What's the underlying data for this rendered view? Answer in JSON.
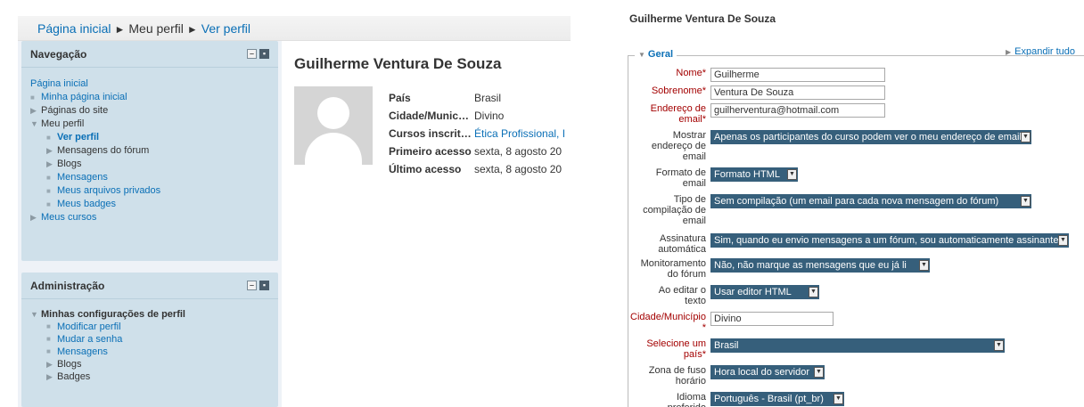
{
  "breadcrumb": {
    "items": [
      "Página inicial",
      "Meu perfil",
      "Ver perfil"
    ],
    "separator": "►"
  },
  "navigation": {
    "title": "Navegação",
    "home": "Página inicial",
    "items": [
      {
        "label": "Minha página inicial"
      },
      {
        "label": "Páginas do site"
      },
      {
        "label": "Meu perfil"
      },
      {
        "label": "Ver perfil"
      },
      {
        "label": "Mensagens do fórum"
      },
      {
        "label": "Blogs"
      },
      {
        "label": "Mensagens"
      },
      {
        "label": "Meus arquivos privados"
      },
      {
        "label": "Meus badges"
      },
      {
        "label": "Meus cursos"
      }
    ]
  },
  "administration": {
    "title": "Administração",
    "section": "Minhas configurações de perfil",
    "items": [
      {
        "label": "Modificar perfil"
      },
      {
        "label": "Mudar a senha"
      },
      {
        "label": "Mensagens"
      },
      {
        "label": "Blogs"
      },
      {
        "label": "Badges"
      }
    ]
  },
  "profile": {
    "name": "Guilherme Ventura De Souza",
    "fields": [
      {
        "key": "País",
        "value": "Brasil"
      },
      {
        "key": "Cidade/Munic…",
        "value": "Divino"
      },
      {
        "key": "Cursos inscrit…",
        "value": "Ética Profissional, I"
      },
      {
        "key": "Primeiro acesso",
        "value": "sexta, 8 agosto 20"
      },
      {
        "key": "Último acesso",
        "value": "sexta, 8 agosto 20"
      }
    ]
  },
  "form": {
    "title": "Guilherme Ventura De Souza",
    "expand_all": "Expandir tudo",
    "legend": "Geral",
    "nome_label": "Nome",
    "nome_value": "Guilherme",
    "sobrenome_label": "Sobrenome",
    "sobrenome_value": "Ventura De Souza",
    "email_label_1": "Endereço de",
    "email_label_2": "email",
    "email_value": "guilherventura@hotmail.com",
    "mostrar_label_1": "Mostrar",
    "mostrar_label_2": "endereço de",
    "mostrar_label_3": "email",
    "mostrar_value": "Apenas os participantes do curso podem ver o meu endereço de email",
    "formato_label_1": "Formato de",
    "formato_label_2": "email",
    "formato_value": "Formato HTML",
    "compilacao_label_1": "Tipo de",
    "compilacao_label_2": "compilação de",
    "compilacao_label_3": "email",
    "compilacao_value": "Sem compilação (um email para cada nova mensagem do fórum)",
    "assinatura_label_1": "Assinatura",
    "assinatura_label_2": "automática",
    "assinatura_value": "Sim, quando eu envio mensagens a um fórum, sou automaticamente assinante",
    "monitoramento_label_1": "Monitoramento",
    "monitoramento_label_2": "do fórum",
    "monitoramento_value": "Não, não marque as mensagens que eu já li",
    "editor_label_1": "Ao editar o",
    "editor_label_2": "texto",
    "editor_value": "Usar editor HTML",
    "cidade_label": "Cidade/Município",
    "cidade_value": "Divino",
    "pais_label_1": "Selecione um",
    "pais_label_2": "país",
    "pais_value": "Brasil",
    "fuso_label_1": "Zona de fuso",
    "fuso_label_2": "horário",
    "fuso_value": "Hora local do servidor",
    "idioma_label_1": "Idioma",
    "idioma_label_2": "preferido",
    "idioma_value": "Português - Brasil (pt_br)",
    "required_marker": "*"
  },
  "colors": {
    "link": "#0a6fb6",
    "required": "#a30000",
    "select_bg": "#365f7b",
    "block_bg": "#cfe0ea"
  }
}
